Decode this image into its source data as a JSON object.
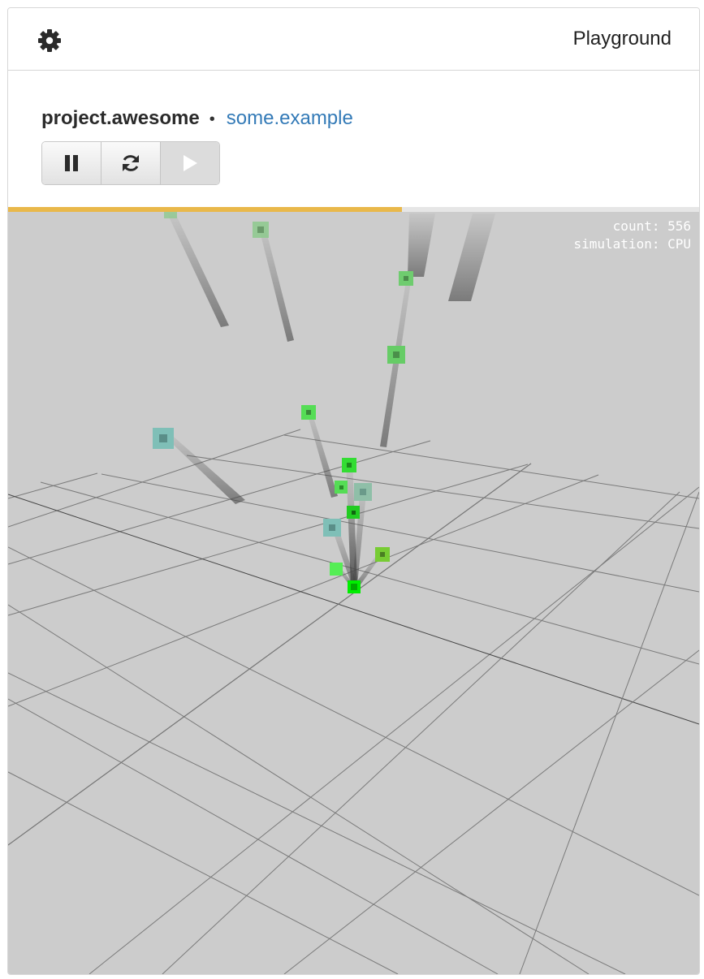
{
  "topbar": {
    "title": "Playground",
    "settings_icon": "gear-icon"
  },
  "header": {
    "project_name": "project.awesome",
    "separator": "•",
    "link_text": "some.example",
    "buttons": [
      {
        "name": "pause-button",
        "icon": "pause-icon"
      },
      {
        "name": "reset-button",
        "icon": "refresh-icon"
      },
      {
        "name": "play-button",
        "icon": "play-icon",
        "disabled": true
      }
    ]
  },
  "progress": {
    "fraction": 0.57
  },
  "simulation": {
    "count_line": "count: 556",
    "mode_line": "simulation: CPU"
  },
  "colors": {
    "accent_progress": "#e9b84a",
    "link": "#337ab7",
    "viewport_bg": "#cccccc",
    "particle_green": "#22dd22",
    "particle_teal": "#7fbfb7"
  }
}
